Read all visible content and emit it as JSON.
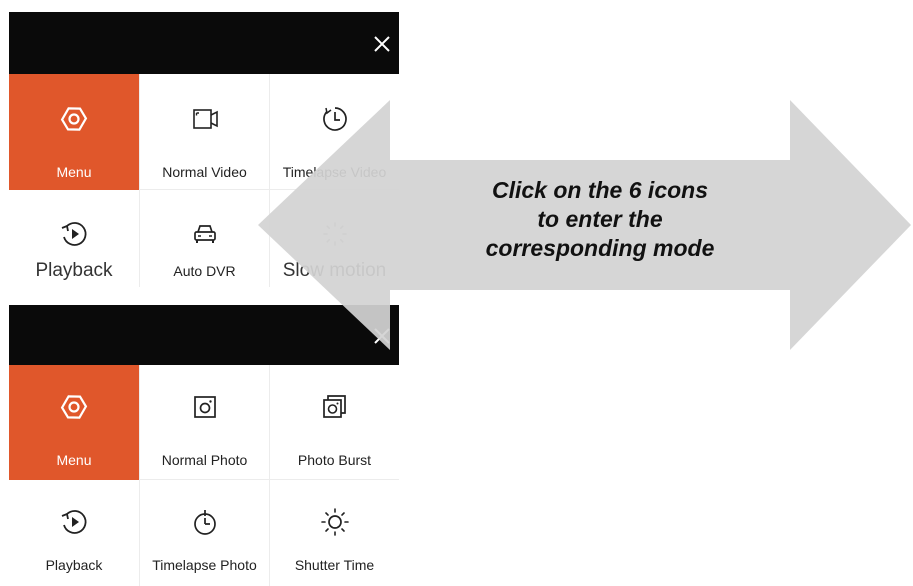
{
  "top_panel": {
    "cells": [
      {
        "label": "Menu",
        "icon": "hex-gear-icon",
        "active": true
      },
      {
        "label": "Normal Video",
        "icon": "video-camera-icon"
      },
      {
        "label": "Timelapse Video",
        "icon": "timer-icon"
      },
      {
        "label": "Playback",
        "icon": "playback-icon"
      },
      {
        "label": "Auto DVR",
        "icon": "car-icon"
      },
      {
        "label": "Slow motion",
        "icon": "slow-motion-icon"
      }
    ]
  },
  "bottom_panel": {
    "cells": [
      {
        "label": "Menu",
        "icon": "hex-gear-icon",
        "active": true
      },
      {
        "label": "Normal Photo",
        "icon": "photo-camera-icon"
      },
      {
        "label": "Photo Burst",
        "icon": "burst-icon"
      },
      {
        "label": "Playback",
        "icon": "playback-icon"
      },
      {
        "label": "Timelapse Photo",
        "icon": "stopwatch-icon"
      },
      {
        "label": "Shutter Time",
        "icon": "sun-icon"
      }
    ]
  },
  "callout": {
    "line1": "Click on the 6 icons",
    "line2": "to enter the",
    "line3": "corresponding mode"
  },
  "colors": {
    "accent": "#e0572b",
    "titlebar": "#0a0a0a",
    "arrow": "#d3d3d3"
  }
}
